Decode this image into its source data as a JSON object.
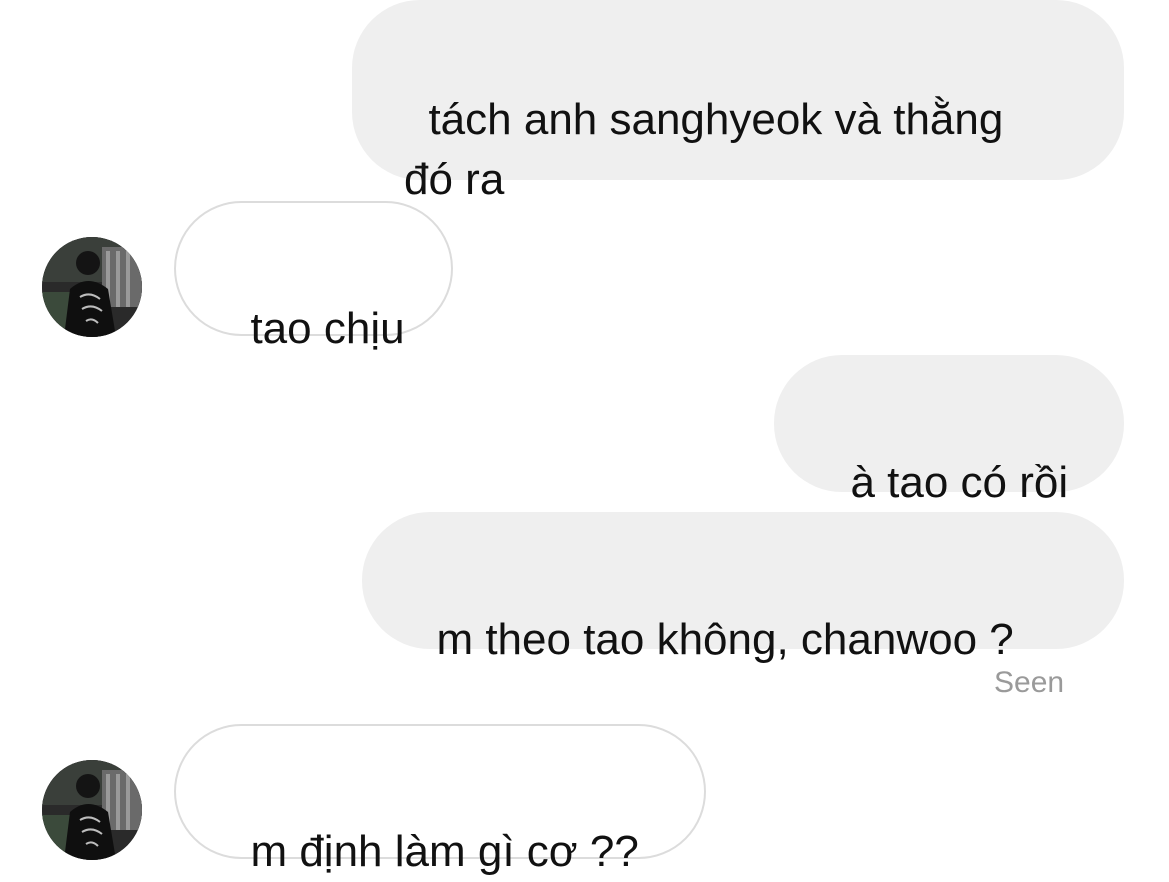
{
  "messages": [
    {
      "direction": "sent",
      "text": "tách anh sanghyeok và thằng\nđó ra"
    },
    {
      "direction": "received",
      "text": "tao chịu"
    },
    {
      "direction": "sent",
      "text": "à tao có rồi"
    },
    {
      "direction": "sent",
      "text": "m theo tao không, chanwoo ?"
    },
    {
      "direction": "received",
      "text": "m định làm gì cơ ??"
    }
  ],
  "status": {
    "seen": "Seen"
  },
  "avatar": {
    "icon": "profile-photo-icon"
  },
  "colors": {
    "sent_bubble": "#efefef",
    "received_border": "#dcdcdc",
    "text": "#111111",
    "seen_text": "#9a9a9a"
  }
}
